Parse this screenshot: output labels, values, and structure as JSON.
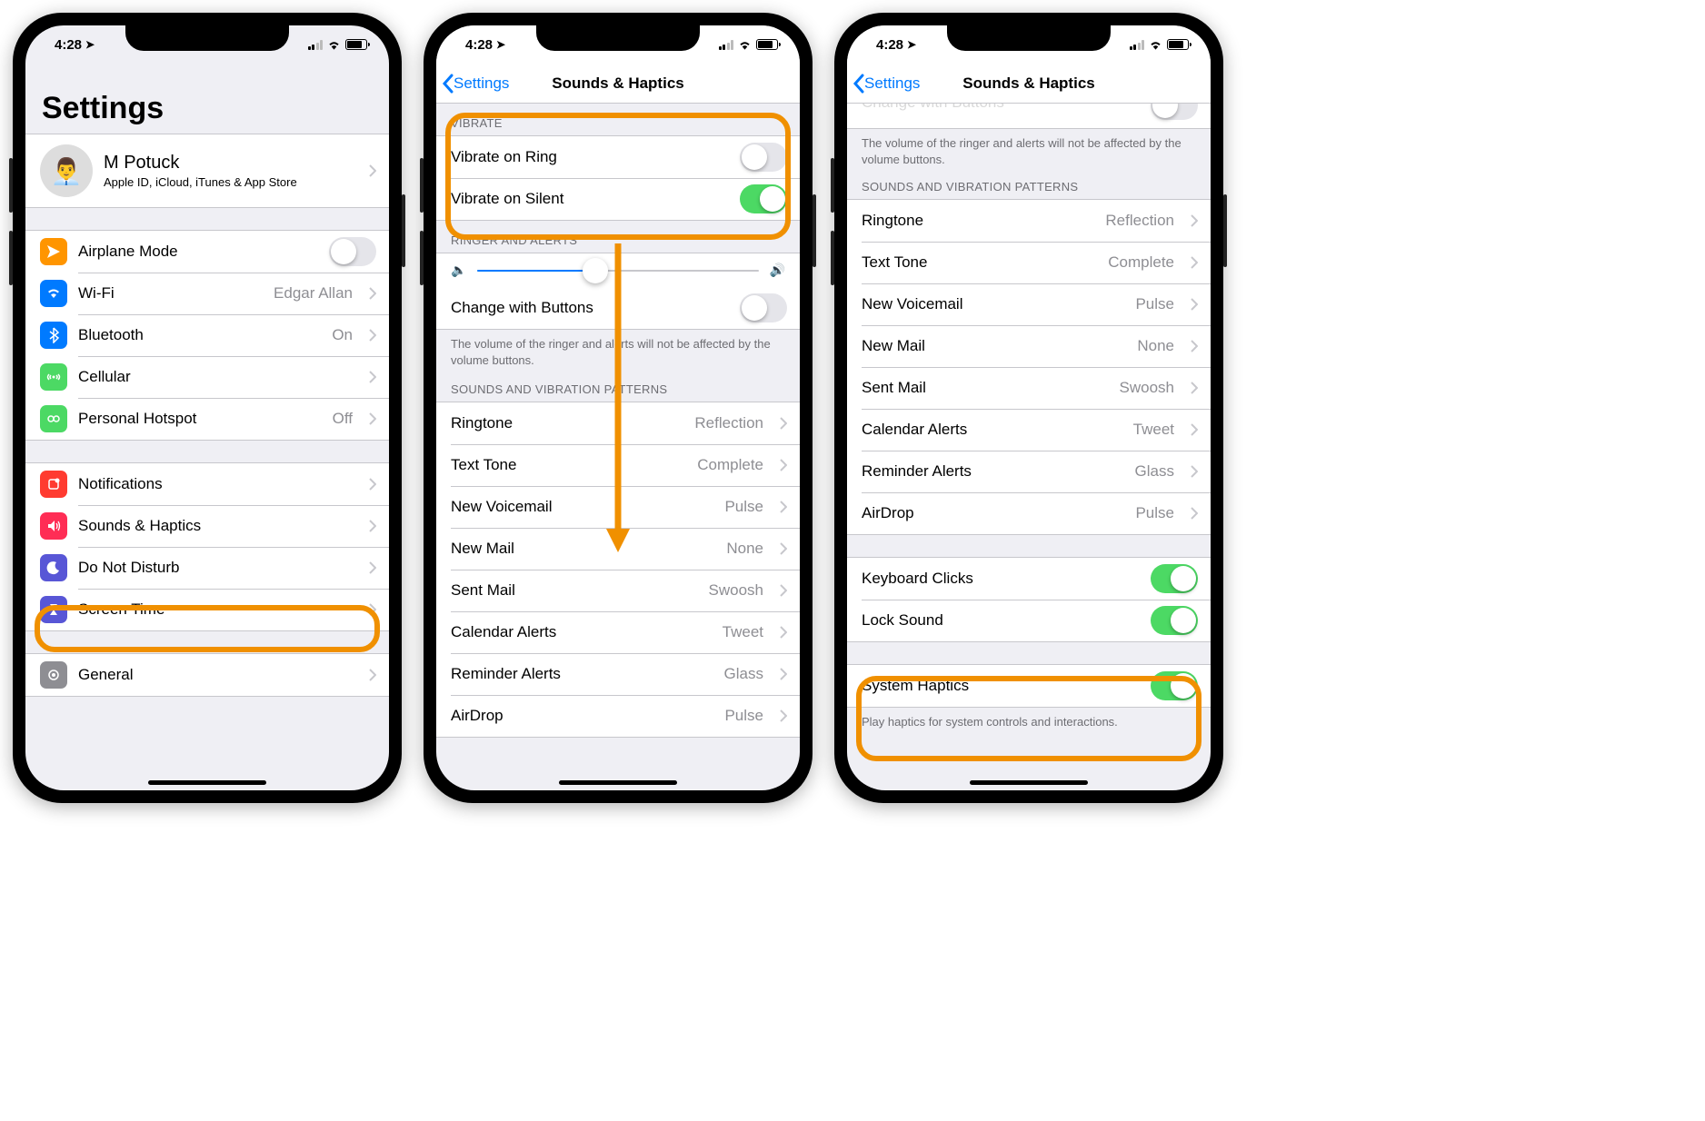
{
  "status": {
    "time": "4:28",
    "battery_pct": 72
  },
  "screen1": {
    "title": "Settings",
    "profile": {
      "name": "M Potuck",
      "sub": "Apple ID, iCloud, iTunes & App Store"
    },
    "g1": {
      "airplane": "Airplane Mode",
      "wifi": "Wi-Fi",
      "wifi_val": "Edgar Allan",
      "bt": "Bluetooth",
      "bt_val": "On",
      "cellular": "Cellular",
      "hotspot": "Personal Hotspot",
      "hotspot_val": "Off"
    },
    "g2": {
      "notifications": "Notifications",
      "sounds": "Sounds & Haptics",
      "dnd": "Do Not Disturb",
      "screentime": "Screen Time"
    },
    "g3": {
      "general": "General"
    }
  },
  "screen2": {
    "back": "Settings",
    "title": "Sounds & Haptics",
    "hdr_vibrate": "VIBRATE",
    "vibrate_ring": "Vibrate on Ring",
    "vibrate_silent": "Vibrate on Silent",
    "hdr_ringer": "RINGER AND ALERTS",
    "change_buttons": "Change with Buttons",
    "volume_note": "The volume of the ringer and alerts will not be affected by the volume buttons.",
    "hdr_patterns": "SOUNDS AND VIBRATION PATTERNS",
    "patterns": [
      {
        "l": "Ringtone",
        "v": "Reflection"
      },
      {
        "l": "Text Tone",
        "v": "Complete"
      },
      {
        "l": "New Voicemail",
        "v": "Pulse"
      },
      {
        "l": "New Mail",
        "v": "None"
      },
      {
        "l": "Sent Mail",
        "v": "Swoosh"
      },
      {
        "l": "Calendar Alerts",
        "v": "Tweet"
      },
      {
        "l": "Reminder Alerts",
        "v": "Glass"
      },
      {
        "l": "AirDrop",
        "v": "Pulse"
      }
    ]
  },
  "screen3": {
    "back": "Settings",
    "title": "Sounds & Haptics",
    "cut_label": "Change with Buttons",
    "volume_note": "The volume of the ringer and alerts will not be affected by the volume buttons.",
    "hdr_patterns": "SOUNDS AND VIBRATION PATTERNS",
    "patterns": [
      {
        "l": "Ringtone",
        "v": "Reflection"
      },
      {
        "l": "Text Tone",
        "v": "Complete"
      },
      {
        "l": "New Voicemail",
        "v": "Pulse"
      },
      {
        "l": "New Mail",
        "v": "None"
      },
      {
        "l": "Sent Mail",
        "v": "Swoosh"
      },
      {
        "l": "Calendar Alerts",
        "v": "Tweet"
      },
      {
        "l": "Reminder Alerts",
        "v": "Glass"
      },
      {
        "l": "AirDrop",
        "v": "Pulse"
      }
    ],
    "keyboard_clicks": "Keyboard Clicks",
    "lock_sound": "Lock Sound",
    "system_haptics": "System Haptics",
    "haptics_note": "Play haptics for system controls and interactions."
  }
}
